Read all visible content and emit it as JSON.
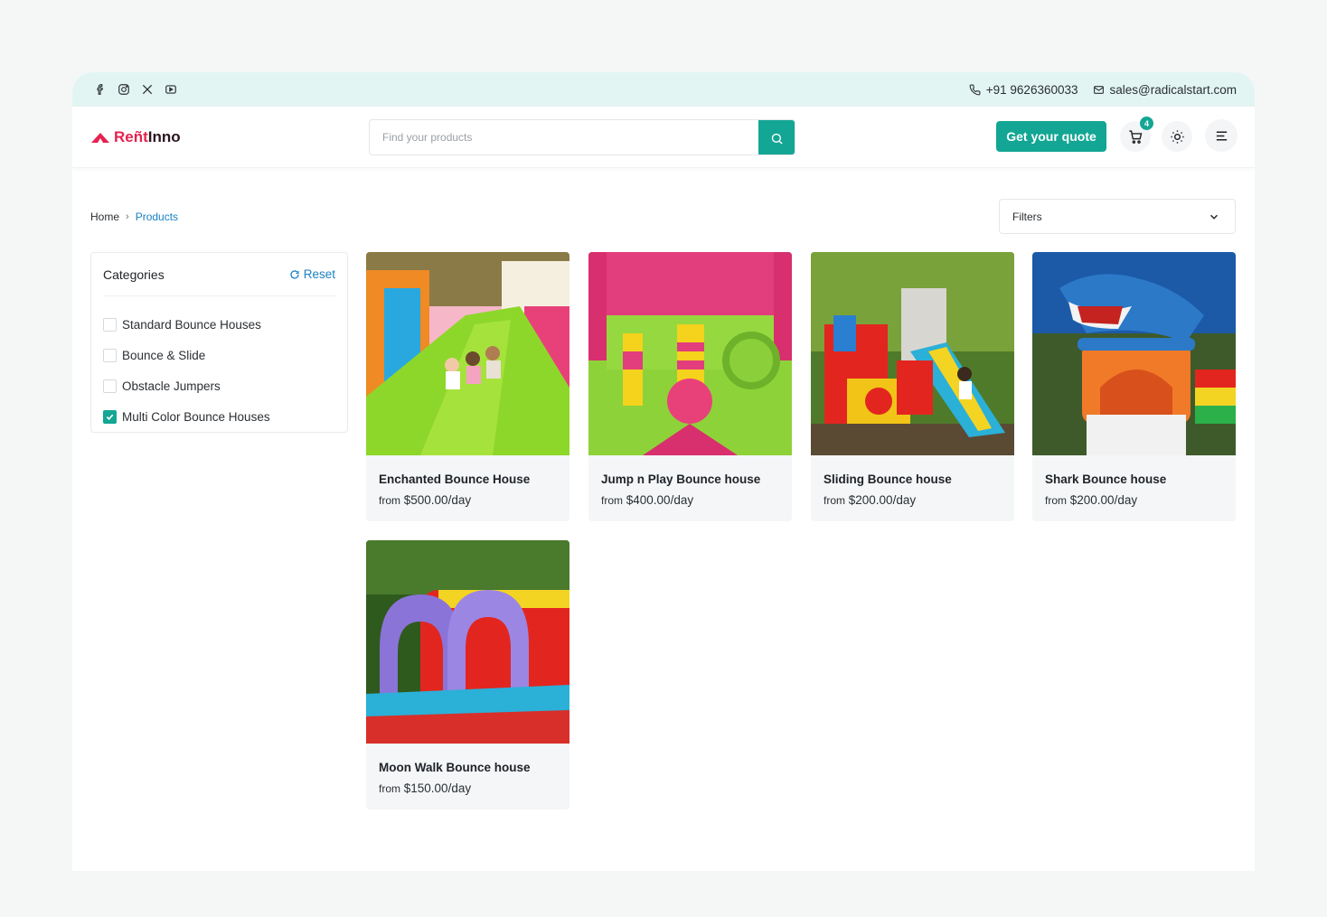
{
  "topbar": {
    "social_icons": [
      "facebook-icon",
      "instagram-icon",
      "x-icon",
      "youtube-icon"
    ],
    "phone": "+91 9626360033",
    "email": "sales@radicalstart.com"
  },
  "header": {
    "logo_part1": "Reñt",
    "logo_part2": "Inno",
    "search_placeholder": "Find your products",
    "quote_label": "Get your quote",
    "cart_count": "4"
  },
  "breadcrumb": {
    "home": "Home",
    "separator": "›",
    "current": "Products"
  },
  "filters_label": "Filters",
  "categories": {
    "title": "Categories",
    "reset_label": "Reset",
    "items": [
      {
        "label": "Standard Bounce Houses",
        "checked": false
      },
      {
        "label": "Bounce & Slide",
        "checked": false
      },
      {
        "label": "Obstacle Jumpers",
        "checked": false
      },
      {
        "label": "Multi Color Bounce Houses",
        "checked": true
      }
    ]
  },
  "products": [
    {
      "name": "Enchanted Bounce House",
      "from": "from",
      "price": "$500.00/day"
    },
    {
      "name": "Jump n Play Bounce house",
      "from": "from",
      "price": "$400.00/day"
    },
    {
      "name": "Sliding Bounce house",
      "from": "from",
      "price": "$200.00/day"
    },
    {
      "name": "Shark Bounce house",
      "from": "from",
      "price": "$200.00/day"
    },
    {
      "name": "Moon Walk Bounce house",
      "from": "from",
      "price": "$150.00/day"
    }
  ],
  "colors": {
    "accent": "#13a694",
    "link": "#1a82c4",
    "brand_red": "#e5224f",
    "topbar_bg": "#e2f5f3"
  }
}
